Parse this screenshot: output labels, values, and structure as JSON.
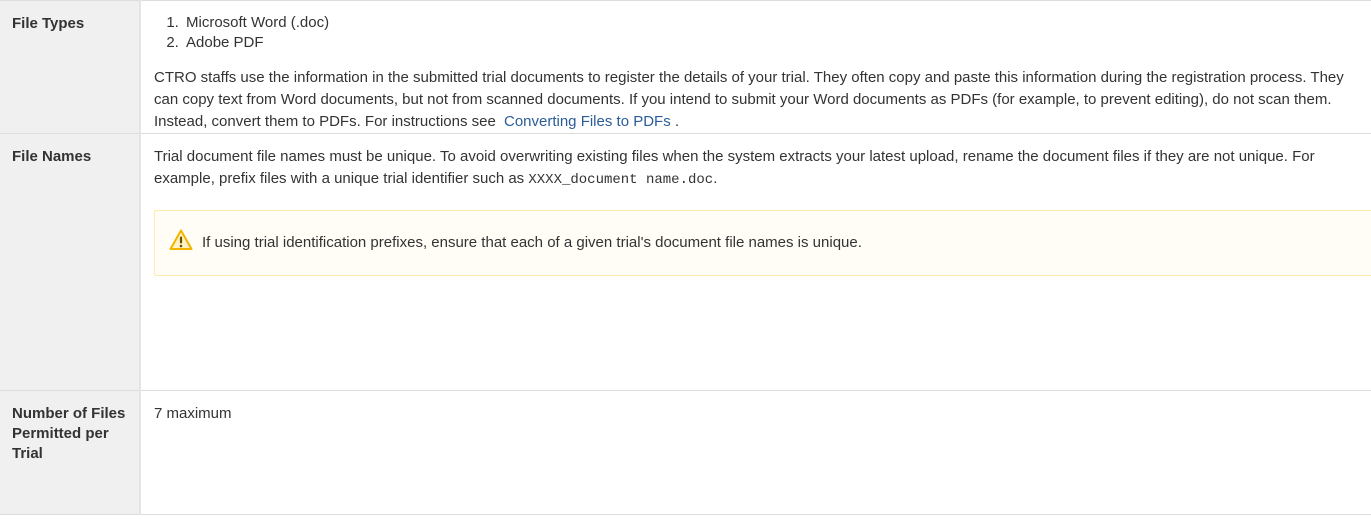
{
  "rows": {
    "file_types": {
      "header": "File Types",
      "list": [
        "Microsoft Word (.doc)",
        "Adobe PDF"
      ],
      "paragraph": "CTRO staffs use the information in the submitted trial documents to register the details of your trial. They often copy and paste this information during the registration process. They can copy text from Word documents, but not from scanned documents. If you intend to submit your Word documents as PDFs (for example, to prevent editing), do not scan them. Instead, convert them to PDFs. For instructions see",
      "link_text": "Converting Files to PDFs",
      "paragraph_end": "."
    },
    "file_names": {
      "header": "File Names",
      "paragraph": "Trial document file names must be unique. To avoid overwriting existing files when the system extracts your latest upload, rename the document files if they are not unique. For example, prefix files with a unique trial identifier such as",
      "code": "XXXX_document name.doc",
      "paragraph_end": ".",
      "warning": {
        "icon": "warning-icon",
        "text": "If using trial identification prefixes, ensure that each of a given trial's document file names is unique."
      }
    },
    "number_of_files": {
      "header": "Number of Files Permitted per Trial",
      "value": "7 maximum"
    }
  },
  "colors": {
    "header_bg": "#f0f0f0",
    "link": "#2a5c9a",
    "warning_bg": "#fffdf6",
    "warning_border": "#ffeaae",
    "warning_icon": "#f1b500"
  }
}
